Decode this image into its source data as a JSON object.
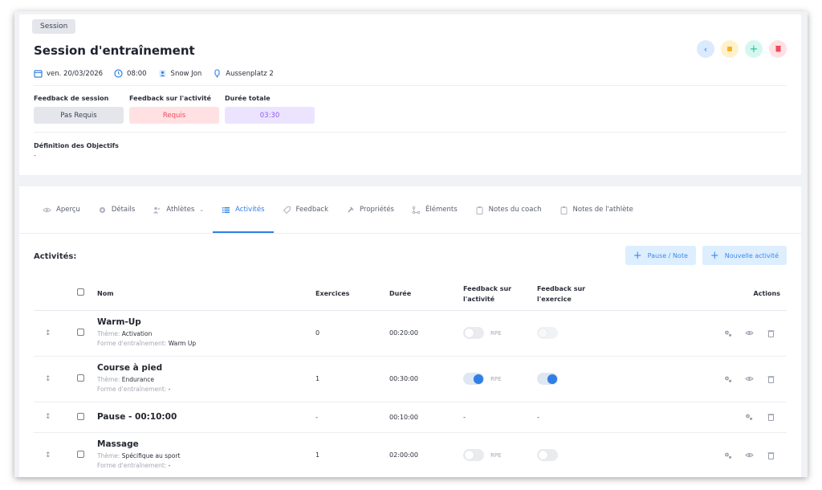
{
  "header": {
    "badge": "Session",
    "title": "Session d'entraînement",
    "date": "ven. 20/03/2026",
    "time": "08:00",
    "coach": "Snow Jon",
    "location": "Aussenplatz 2"
  },
  "feedback": {
    "session_label": "Feedback de session",
    "session_value": "Pas Requis",
    "activity_label": "Feedback sur l'activité",
    "activity_value": "Requis",
    "duration_label": "Durée totale",
    "duration_value": "03:30"
  },
  "objectives": {
    "label": "Définition des Objectifs",
    "value": "-"
  },
  "tabs": [
    {
      "label": "Aperçu",
      "icon": "eye-icon"
    },
    {
      "label": "Détails",
      "icon": "gear-icon"
    },
    {
      "label": "Athlètes",
      "icon": "users-icon"
    },
    {
      "label": "Activités",
      "icon": "list-icon"
    },
    {
      "label": "Feedback",
      "icon": "tag-icon"
    },
    {
      "label": "Propriétés",
      "icon": "pin-icon"
    },
    {
      "label": "Éléments",
      "icon": "nodes-icon"
    },
    {
      "label": "Notes du coach",
      "icon": "clipboard-icon"
    },
    {
      "label": "Notes de l'athlète",
      "icon": "clipboard-icon"
    }
  ],
  "activities": {
    "title": "Activités:",
    "pause_button": "Pause / Note",
    "new_button": "Nouvelle activité",
    "columns": {
      "name": "Nom",
      "exercises": "Exercices",
      "duration": "Durée",
      "fb_activity_1": "Feedback sur",
      "fb_activity_2": "l'activité",
      "fb_exercise_1": "Feedback sur",
      "fb_exercise_2": "l'exercice",
      "actions": "Actions"
    },
    "theme_label": "Thème:",
    "form_label": "Forme d'entraînement:",
    "rpe": "RPE",
    "rows": [
      {
        "name": "Warm-Up",
        "theme": "Activation",
        "form": "Warm Up",
        "exercises": "0",
        "duration": "00:20:00"
      },
      {
        "name": "Course à pied",
        "theme": "Endurance",
        "form": "-",
        "exercises": "1",
        "duration": "00:30:00"
      },
      {
        "name": "Pause - 00:10:00",
        "exercises": "-",
        "duration": "00:10:00",
        "fb_activity": "-",
        "fb_exercise": "-"
      },
      {
        "name": "Massage",
        "theme": "Spécifique au sport",
        "form": "-",
        "exercises": "1",
        "duration": "02:00:00"
      }
    ]
  },
  "colors": {
    "accent": "#2f7fe6",
    "pill_neutral": "#e4e6ec",
    "pill_required": "#ffe1e4",
    "pill_duration": "#ece4ff",
    "btn_back": "#dbeafe",
    "btn_stop": "#fff1cc",
    "btn_add": "#d6f7ef",
    "btn_delete": "#ffe1e4"
  }
}
